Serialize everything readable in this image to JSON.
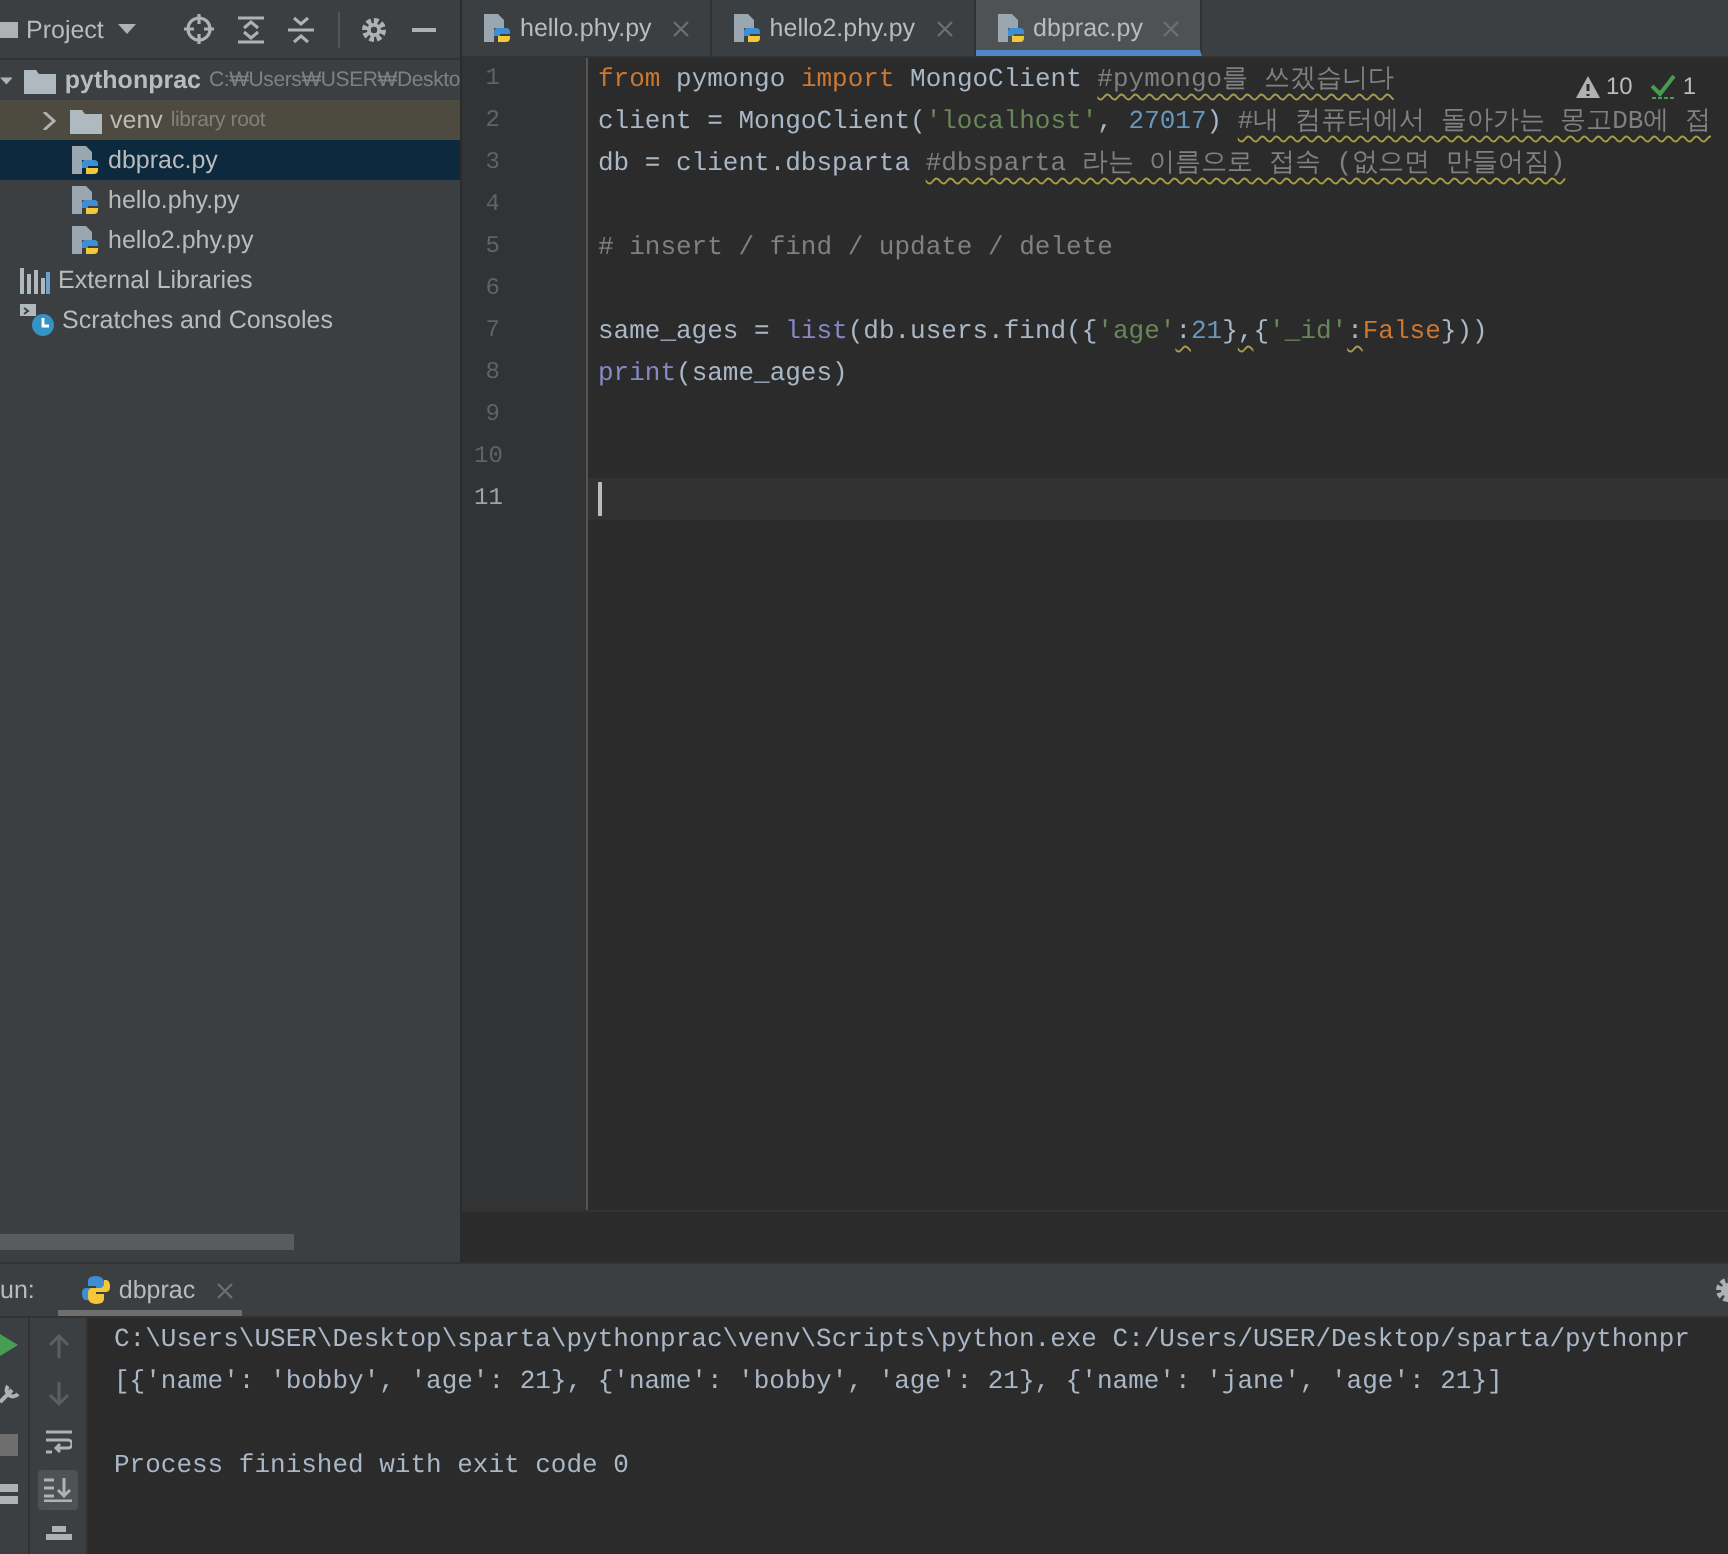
{
  "project_panel": {
    "title": "Project",
    "tree": [
      {
        "label": "pythonprac",
        "hint": "C:₩Users₩USER₩Deskto",
        "kind": "folder",
        "expanded": true,
        "selected": false,
        "children": [
          {
            "label": "venv",
            "hint": "library root",
            "kind": "library_folder",
            "expanded": false,
            "selected": false
          },
          {
            "label": "dbprac.py",
            "kind": "python",
            "selected": true
          },
          {
            "label": "hello.phy.py",
            "kind": "python",
            "selected": false
          },
          {
            "label": "hello2.phy.py",
            "kind": "python",
            "selected": false
          }
        ]
      },
      {
        "label": "External Libraries",
        "kind": "libraries",
        "selected": false
      },
      {
        "label": "Scratches and Consoles",
        "kind": "scratches",
        "selected": false
      }
    ]
  },
  "editor": {
    "tabs": [
      {
        "label": "hello.phy.py",
        "selected": false
      },
      {
        "label": "hello2.phy.py",
        "selected": false
      },
      {
        "label": "dbprac.py",
        "selected": true
      }
    ],
    "inspections": {
      "warnings": "10",
      "passed": "1"
    },
    "lines": [
      {
        "number": "1",
        "current": false,
        "tokens": [
          {
            "text": "from",
            "kind": "keyword",
            "warned": false
          },
          {
            "text": " pymongo ",
            "kind": "name",
            "warned": false
          },
          {
            "text": "import",
            "kind": "keyword",
            "warned": false
          },
          {
            "text": " MongoClient ",
            "kind": "name",
            "warned": false
          },
          {
            "text": "#pymongo를 쓰겠습니다",
            "kind": "comment",
            "warned": true
          }
        ]
      },
      {
        "number": "2",
        "current": false,
        "tokens": [
          {
            "text": "client = MongoClient(",
            "kind": "name",
            "warned": false
          },
          {
            "text": "'localhost'",
            "kind": "string",
            "warned": false
          },
          {
            "text": ", ",
            "kind": "name",
            "warned": false
          },
          {
            "text": "27017",
            "kind": "number",
            "warned": false
          },
          {
            "text": ") ",
            "kind": "name",
            "warned": false
          },
          {
            "text": "#내 컴퓨터에서 돌아가는 몽고DB에 접",
            "kind": "comment",
            "warned": true
          }
        ]
      },
      {
        "number": "3",
        "current": false,
        "tokens": [
          {
            "text": "db = client.dbsparta ",
            "kind": "name",
            "warned": false
          },
          {
            "text": "#dbsparta 라는 이름으로 접속 (없으면 만들어짐)",
            "kind": "comment",
            "warned": true
          }
        ]
      },
      {
        "number": "4",
        "current": false
      },
      {
        "number": "5",
        "current": false,
        "tokens": [
          {
            "text": "# insert / find / update / delete",
            "kind": "comment",
            "warned": false
          }
        ]
      },
      {
        "number": "6",
        "current": false
      },
      {
        "number": "7",
        "current": false,
        "tokens": [
          {
            "text": "same_ages = ",
            "kind": "name",
            "warned": false
          },
          {
            "text": "list",
            "kind": "builtin",
            "warned": false
          },
          {
            "text": "(db.users.find({",
            "kind": "name",
            "warned": false
          },
          {
            "text": "'age'",
            "kind": "string",
            "warned": false
          },
          {
            "text": ":",
            "kind": "name",
            "warned": true
          },
          {
            "text": "21",
            "kind": "number",
            "warned": false
          },
          {
            "text": "}",
            "kind": "name",
            "warned": false
          },
          {
            "text": ",",
            "kind": "name",
            "warned": true
          },
          {
            "text": "{",
            "kind": "name",
            "warned": false
          },
          {
            "text": "'_id'",
            "kind": "string",
            "warned": false
          },
          {
            "text": ":",
            "kind": "name",
            "warned": true
          },
          {
            "text": "False",
            "kind": "keyword",
            "warned": false
          },
          {
            "text": "}))",
            "kind": "name",
            "warned": false
          }
        ]
      },
      {
        "number": "8",
        "current": false,
        "tokens": [
          {
            "text": "print",
            "kind": "builtin",
            "warned": false
          },
          {
            "text": "(same_ages)",
            "kind": "name",
            "warned": false
          }
        ]
      },
      {
        "number": "9",
        "current": false
      },
      {
        "number": "10",
        "current": false
      },
      {
        "number": "11",
        "current": true
      }
    ]
  },
  "run_panel": {
    "label": "un:",
    "tab": "dbprac",
    "scroll_to_end_on": true,
    "console": [
      {
        "text": "C:\\Users\\USER\\Desktop\\sparta\\pythonprac\\venv\\Scripts\\python.exe C:/Users/USER/Desktop/sparta/pythonpr",
        "kind": "command"
      },
      {
        "text": "[{'name': 'bobby', 'age': 21}, {'name': 'bobby', 'age': 21}, {'name': 'jane', 'age': 21}]",
        "kind": "output"
      },
      {
        "text": "Process finished with exit code 0",
        "kind": "status"
      }
    ]
  }
}
